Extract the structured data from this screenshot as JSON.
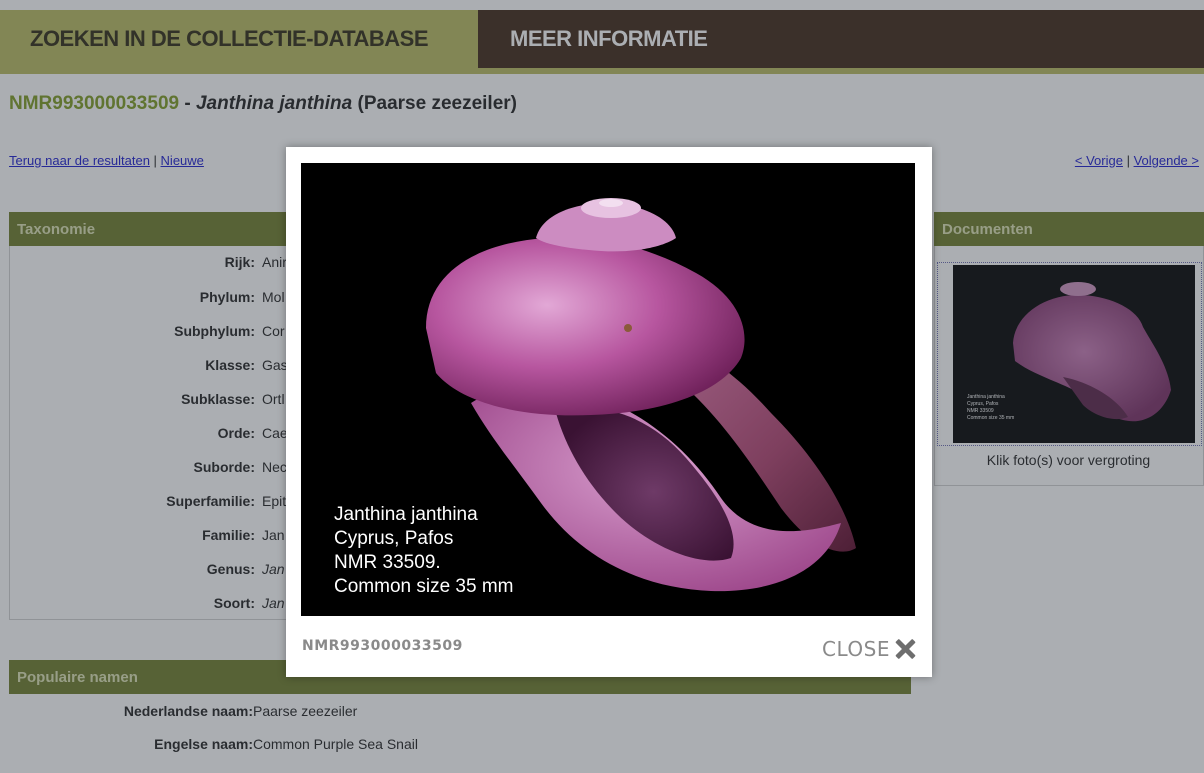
{
  "tabs": {
    "search": "ZOEKEN IN DE COLLECTIE-DATABASE",
    "more_info": "MEER INFORMATIE"
  },
  "record": {
    "number": "NMR993000033509",
    "separator": " - ",
    "species": "Janthina janthina",
    "common": " (Paarse zeezeiler)"
  },
  "nav": {
    "back": "Terug naar de resultaten",
    "sep1": " | ",
    "new": "Nieuwe",
    "prev": "< Vorige",
    "sep2": " | ",
    "next": "Volgende >"
  },
  "taxonomy": {
    "header": "Taxonomie",
    "rows": [
      {
        "label": "Rijk:",
        "value": "Anir"
      },
      {
        "label": "Phylum:",
        "value": "Mol"
      },
      {
        "label": "Subphylum:",
        "value": "Cor"
      },
      {
        "label": "Klasse:",
        "value": "Gas"
      },
      {
        "label": "Subklasse:",
        "value": "Ortl"
      },
      {
        "label": "Orde:",
        "value": "Cae"
      },
      {
        "label": "Suborde:",
        "value": "Nec"
      },
      {
        "label": "Superfamilie:",
        "value": "Epit"
      },
      {
        "label": "Familie:",
        "value": "Jan"
      },
      {
        "label": "Genus:",
        "value": "Jan"
      },
      {
        "label": "Soort:",
        "value": "Jan"
      }
    ]
  },
  "documents": {
    "header": "Documenten",
    "thumb_caption": "Klik foto(s) voor vergroting",
    "thumb_text": [
      "Janthina janthina",
      "Cyprus, Pafos",
      "NMR 33509",
      "Common size 35 mm"
    ]
  },
  "popular_names": {
    "header": "Populaire namen",
    "rows": [
      {
        "label": "Nederlandse naam:",
        "value": "Paarse zeezeiler"
      },
      {
        "label": "Engelse naam:",
        "value": "Common Purple Sea Snail"
      }
    ]
  },
  "modal": {
    "caption_lines": [
      "Janthina janthina",
      "Cyprus, Pafos",
      "NMR 33509.",
      "Common size 35 mm"
    ],
    "id": "NMR993000033509",
    "close_label": "CLOSE"
  },
  "colors": {
    "olive": "#b8bb5f",
    "dark_brown": "#3e2616",
    "panel_green": "#6f7d2a",
    "record_green": "#7f9b22",
    "link_blue": "#1a1ad0",
    "shell_purple": "#b7569f"
  }
}
